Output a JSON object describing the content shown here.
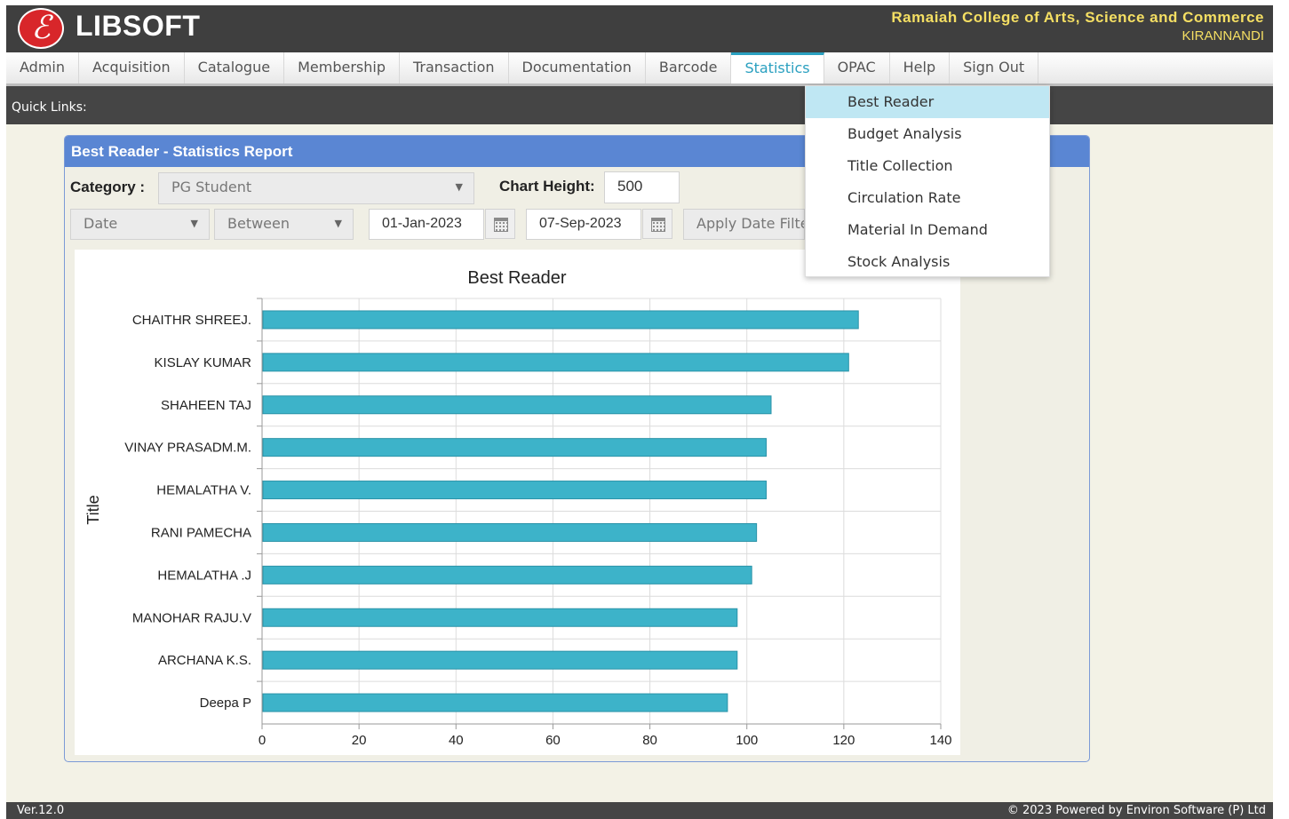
{
  "app": {
    "logo_glyph": "ℰ",
    "brand": "LIBSOFT",
    "college": "Ramaiah College of Arts, Science and Commerce",
    "user": "KIRANNANDI"
  },
  "menu": [
    {
      "label": "Admin",
      "active": false
    },
    {
      "label": "Acquisition",
      "active": false
    },
    {
      "label": "Catalogue",
      "active": false
    },
    {
      "label": "Membership",
      "active": false
    },
    {
      "label": "Transaction",
      "active": false
    },
    {
      "label": "Documentation",
      "active": false
    },
    {
      "label": "Barcode",
      "active": false
    },
    {
      "label": "Statistics",
      "active": true
    },
    {
      "label": "OPAC",
      "active": false
    },
    {
      "label": "Help",
      "active": false
    },
    {
      "label": "Sign Out",
      "active": false
    }
  ],
  "quick_links": {
    "label": "Quick Links:"
  },
  "panel": {
    "title": "Best Reader - Statistics Report"
  },
  "filters": {
    "category_label": "Category :",
    "category_value": "PG Student",
    "chart_height_label": "Chart Height:",
    "chart_height_value": "500",
    "date_field": "Date",
    "condition": "Between",
    "from_date": "01-Jan-2023",
    "to_date": "07-Sep-2023",
    "apply_label": "Apply Date Filter"
  },
  "statistics_menu": [
    {
      "label": "Best Reader",
      "selected": true
    },
    {
      "label": "Budget Analysis",
      "selected": false
    },
    {
      "label": "Title Collection",
      "selected": false
    },
    {
      "label": "Circulation Rate",
      "selected": false
    },
    {
      "label": "Material In Demand",
      "selected": false
    },
    {
      "label": "Stock Analysis",
      "selected": false
    }
  ],
  "chart_data": {
    "type": "bar",
    "orientation": "horizontal",
    "title": "Best Reader",
    "ylabel": "Title",
    "xlabel": "",
    "categories": [
      "CHAITHR SHREEJ.",
      "KISLAY KUMAR",
      "SHAHEEN TAJ",
      "VINAY PRASADM.M.",
      "HEMALATHA V.",
      "RANI PAMECHA",
      "HEMALATHA .J",
      "MANOHAR RAJU.V",
      "ARCHANA K.S.",
      "Deepa P"
    ],
    "values": [
      123,
      121,
      105,
      104,
      104,
      102,
      101,
      98,
      98,
      96
    ],
    "xlim": [
      0,
      140
    ],
    "xticks": [
      0,
      20,
      40,
      60,
      80,
      100,
      120,
      140
    ],
    "grid": true,
    "legend": "none",
    "bar_color": "#3db3c9"
  },
  "footer": {
    "version": "Ver.12.0",
    "powered": "© 2023 Powered by Environ Software (P) Ltd"
  }
}
